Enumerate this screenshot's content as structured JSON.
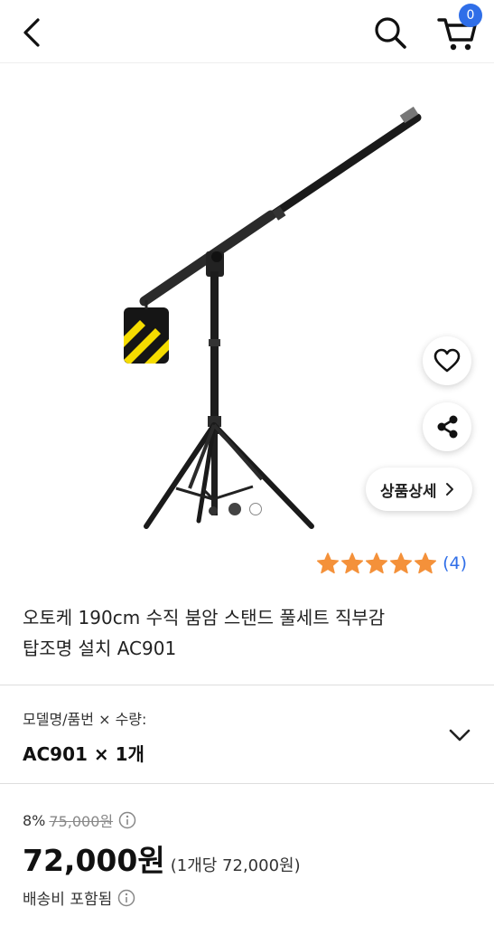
{
  "header": {
    "cart_count": "0"
  },
  "gallery": {
    "image_count": 2,
    "active_index": 0
  },
  "actions": {
    "detail_label": "상품상세"
  },
  "rating": {
    "stars": 5,
    "review_count": "(4)"
  },
  "product": {
    "title_line1": "오토케 190cm 수직 붐암 스탠드 풀세트 직부감",
    "title_line2": "탑조명 설치 AC901"
  },
  "option": {
    "label": "모델명/품번 × 수량:",
    "value": "AC901 × 1개"
  },
  "price": {
    "discount": "8%",
    "original": "75,000원",
    "current": "72,000원",
    "unit": "(1개당 72,000원)",
    "shipping": "배송비 포함됨"
  },
  "colors": {
    "accent": "#2f6ee8",
    "star": "#f4913a"
  }
}
